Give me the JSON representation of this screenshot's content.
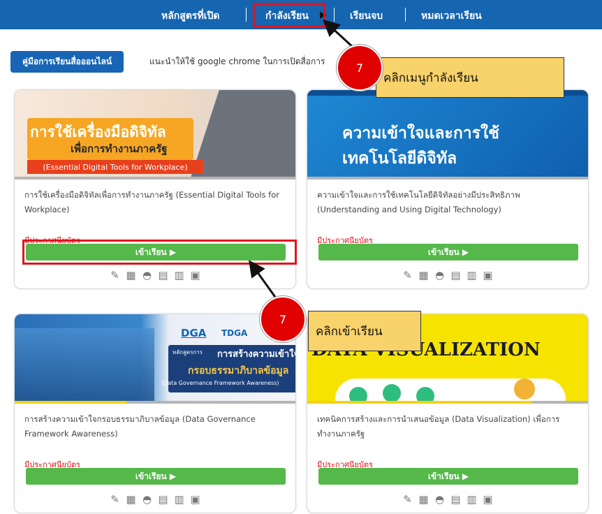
{
  "nav": {
    "items": [
      "หลักสูตรที่เปิด",
      "กำลังเรียน",
      "เรียนจบ",
      "หมดเวลาเรียน"
    ]
  },
  "manual": {
    "button_label": "คู่มือการเรียนสื่อออนไลน์",
    "note": "แนะนำให้ใช้ google chrome ในการเปิดสื่อการ"
  },
  "courses": [
    {
      "banner_line1": "การใช้เครื่องมือดิจิทัล",
      "banner_line2": "เพื่อการทำงานภาครัฐ",
      "banner_line3": "(Essential Digital Tools for Workplace)",
      "title": "การใช้เครื่องมือดิจิทัลเพื่อการทำงานภาครัฐ (Essential Digital Tools for Workplace)",
      "certificate": "มีประกาศนียบัตร",
      "enter_label": "เข้าเรียน ▶"
    },
    {
      "banner_line1": "ความเข้าใจและการใช้",
      "banner_line2": "เทคโนโลยีดิจิทัล",
      "title": "ความเข้าใจและการใช้เทคโนโลยีดิจิทัลอย่างมีประสิทธิภาพ (Understanding and Using Digital Technology)",
      "certificate": "มีประกาศนียบัตร",
      "enter_label": "เข้าเรียน ▶"
    },
    {
      "logo1": "DGA",
      "logo2": "TDGA",
      "banner_small": "หลักสูตรการ",
      "banner_line1": "การสร้างความเข้าใจ",
      "banner_line2": "กรอบธรรมาภิบาลข้อมูล",
      "banner_line3": "(Data Governance Framework Awareness)",
      "title": "การสร้างความเข้าใจกรอบธรรมาภิบาลข้อมูล (Data Governance Framework Awareness)",
      "certificate": "มีประกาศนียบัตร",
      "enter_label": "เข้าเรียน ▶"
    },
    {
      "banner_line1": "DATA VISUALIZATION",
      "title": "เทคนิคการสร้างและการนำเสนอข้อมูล (Data Visualization) เพื่อการทำงานภาครัฐ",
      "certificate": "มีประกาศนียบัตร",
      "enter_label": "เข้าเรียน ▶"
    }
  ],
  "callouts": [
    {
      "step": "7",
      "text": "คลิกเมนูกำลังเรียน"
    },
    {
      "step": "7",
      "text": "คลิกเข้าเรียน"
    }
  ],
  "colors": {
    "nav_bg": "#1565b0",
    "enter_button": "#55b84a",
    "certificate_text": "#e0141c",
    "highlight": "#e0141c",
    "step_circle": "#e00000",
    "callout_bg": "#f8d26a"
  },
  "card_icons": [
    "edit-icon",
    "calendar-icon",
    "globe-icon",
    "book-icon",
    "document-icon",
    "chat-icon"
  ]
}
